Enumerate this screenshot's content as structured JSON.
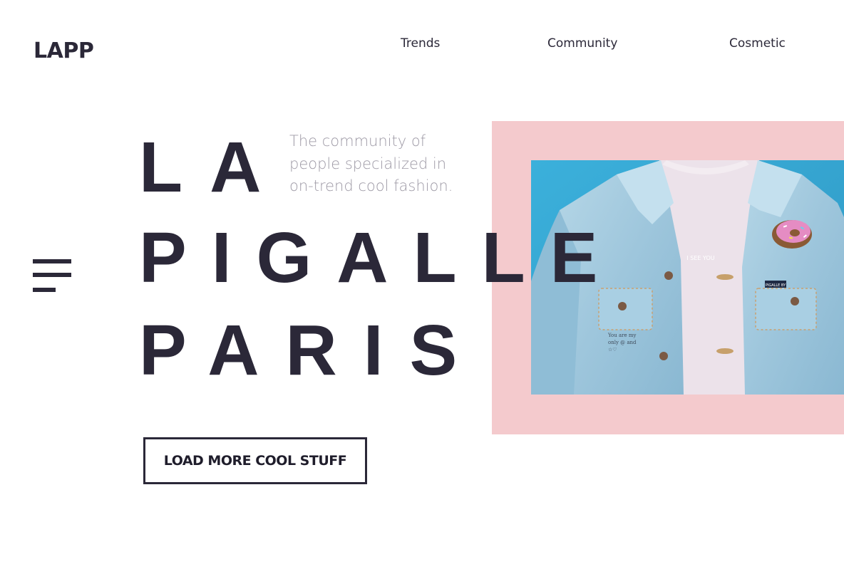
{
  "header": {
    "logo": "LAPP",
    "nav": [
      {
        "label": "Trends"
      },
      {
        "label": "Community"
      },
      {
        "label": "Cosmetic"
      }
    ]
  },
  "hero": {
    "title_lines": [
      "LA",
      "PIGALLE",
      "PARIS"
    ],
    "tagline_lines": [
      "The community of",
      "people specialized in",
      "on-trend cool fashion."
    ],
    "cta_label": "LOAD MORE COOL STUFF",
    "photo_text": {
      "tshirt": "I SEE YOU",
      "tag": "PIGALLE BY",
      "handwriting_lines": [
        "You are my",
        "only @ and",
        "☆♡"
      ]
    }
  },
  "colors": {
    "text_dark": "#2b2838",
    "pink_block": "#f4cacd",
    "photo_background": "#38a9d6",
    "tagline_gray": "#9e9aa6"
  },
  "icons": [
    "menu-icon"
  ]
}
